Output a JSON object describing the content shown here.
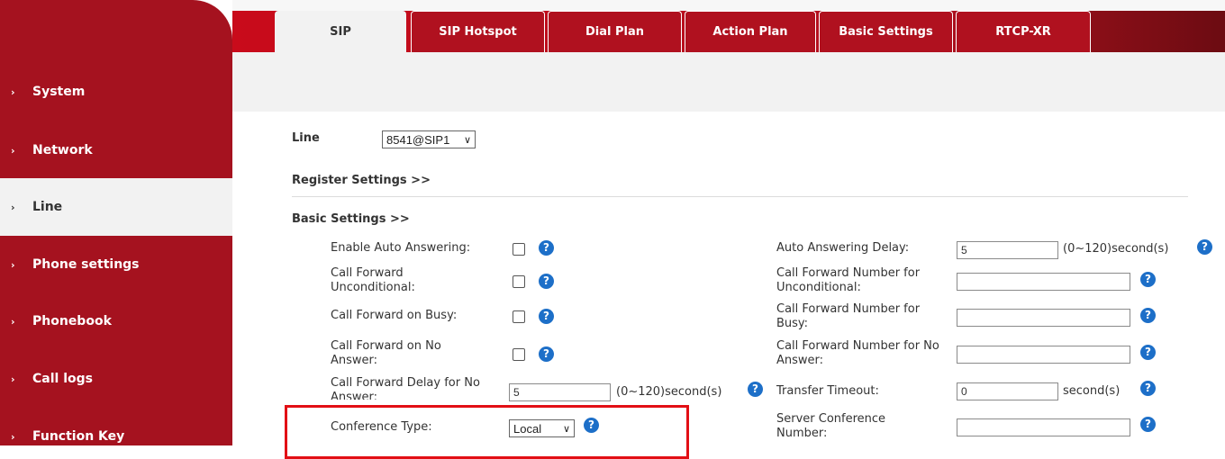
{
  "sidebar": {
    "items": [
      {
        "label": "System"
      },
      {
        "label": "Network"
      },
      {
        "label": "Line"
      },
      {
        "label": "Phone settings"
      },
      {
        "label": "Phonebook"
      },
      {
        "label": "Call logs"
      },
      {
        "label": "Function Key"
      }
    ],
    "bullet": "›",
    "active": "Line"
  },
  "tabs": [
    {
      "label": "SIP"
    },
    {
      "label": "SIP Hotspot"
    },
    {
      "label": "Dial Plan"
    },
    {
      "label": "Action Plan"
    },
    {
      "label": "Basic Settings"
    },
    {
      "label": "RTCP-XR"
    }
  ],
  "line": {
    "label": "Line",
    "value": "8541@SIP1"
  },
  "sections": {
    "register": "Register Settings >>",
    "basic": "Basic Settings >>"
  },
  "fields": {
    "enable_auto_answering": "Enable Auto Answering:",
    "cf_unconditional": "Call Forward Unconditional:",
    "cf_busy": "Call Forward on Busy:",
    "cf_no_answer": "Call Forward on No Answer:",
    "cf_delay": "Call Forward Delay for No Answer:",
    "cf_delay_value": "5",
    "cf_delay_unit": "(0~120)second(s)",
    "conference_type": "Conference Type:",
    "conference_type_value": "Local",
    "auto_answer_delay": "Auto Answering Delay:",
    "auto_answer_delay_value": "5",
    "auto_answer_delay_unit": "(0~120)second(s)",
    "cf_num_unconditional": "Call Forward Number for Unconditional:",
    "cf_num_busy": "Call Forward Number for Busy:",
    "cf_num_no_answer": "Call Forward Number for No Answer:",
    "transfer_timeout": "Transfer Timeout:",
    "transfer_timeout_value": "0",
    "transfer_timeout_unit": "second(s)",
    "server_conference_number": "Server Conference Number:"
  },
  "help_glyph": "?",
  "chevron_glyph": "∨",
  "colors": {
    "brand_red": "#a5121f",
    "help_blue": "#1d6fc8",
    "highlight_red": "#e20f15"
  }
}
